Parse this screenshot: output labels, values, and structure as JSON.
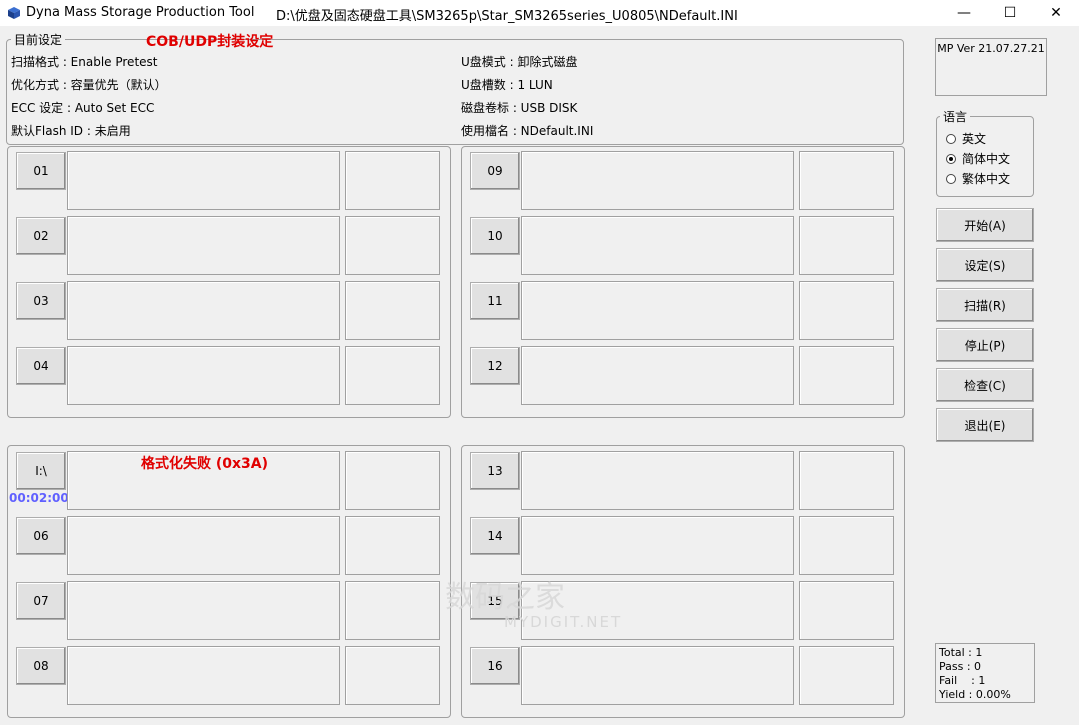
{
  "window": {
    "app_title": "Dyna Mass Storage Production Tool",
    "path": "D:\\优盘及固态硬盘工具\\SM3265p\\Star_SM3265series_U0805\\NDefault.INI",
    "minimize": "—",
    "maximize": "☐",
    "close": "✕"
  },
  "settings": {
    "legend": "目前设定",
    "banner": "COB/UDP封装设定",
    "left": [
      "扫描格式 : Enable Pretest",
      "优化方式 : 容量优先（默认）",
      "ECC 设定 : Auto Set ECC",
      "默认Flash ID : 未启用"
    ],
    "right": [
      "U盘模式 : 卸除式磁盘",
      "U盘槽数 : 1 LUN",
      "磁盘卷标 : USB DISK",
      "使用檔名 : NDefault.INI"
    ]
  },
  "version": "MP Ver 21.07.27.21",
  "language": {
    "legend": "语言",
    "options": [
      "英文",
      "简体中文",
      "繁体中文"
    ],
    "selected": "简体中文"
  },
  "buttons": {
    "start": "开始(A)",
    "settings": "设定(S)",
    "scan": "扫描(R)",
    "stop": "停止(P)",
    "check": "检查(C)",
    "exit": "退出(E)"
  },
  "slots": {
    "s01": "01",
    "s02": "02",
    "s03": "03",
    "s04": "04",
    "s05": "I:\\",
    "s06": "06",
    "s07": "07",
    "s08": "08",
    "s09": "09",
    "s10": "10",
    "s11": "11",
    "s12": "12",
    "s13": "13",
    "s14": "14",
    "s15": "15",
    "s16": "16"
  },
  "slot5": {
    "status": "格式化失败 (0x3A)",
    "timer": "00:02:00"
  },
  "stats": {
    "total": "Total : 1",
    "pass": "Pass : 0",
    "fail": "Fail    : 1",
    "yield": "Yield : 0.00%"
  },
  "watermark": {
    "main": "数码之家",
    "sub": "MYDIGIT.NET"
  },
  "colors": {
    "error": "#e00000",
    "timer": "#6060ff"
  }
}
